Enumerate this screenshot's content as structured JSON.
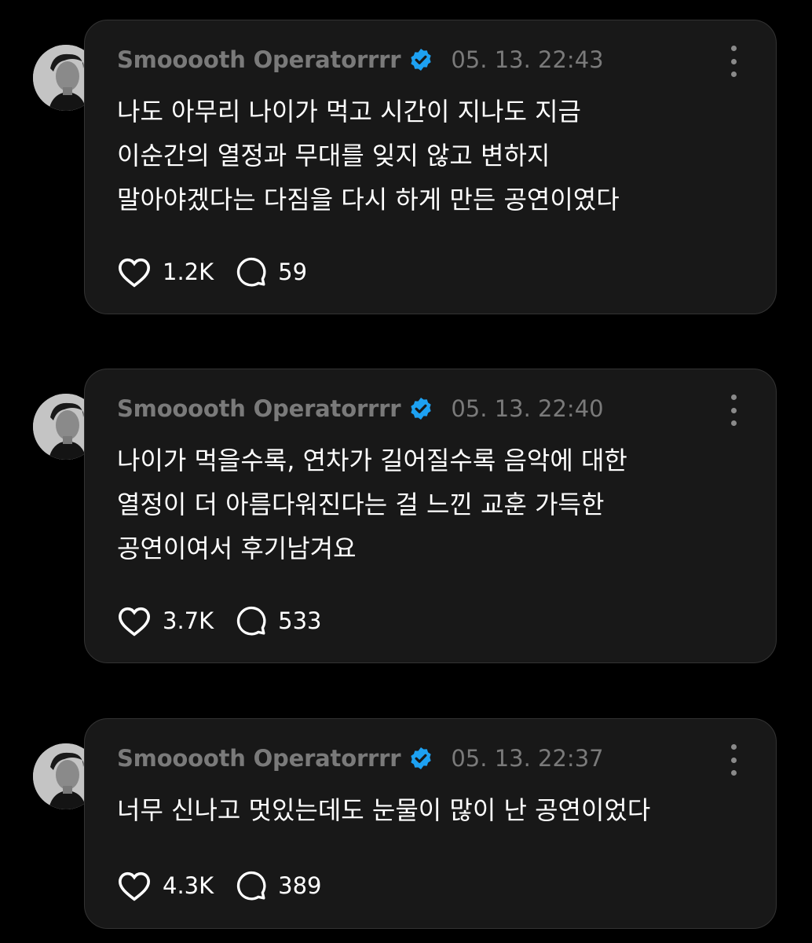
{
  "posts": [
    {
      "author": "Smooooth Operatorrrr",
      "time": "05. 13. 22:43",
      "lines": [
        "나도 아무리 나이가 먹고 시간이 지나도 지금",
        "이순간의 열정과 무대를 잊지 않고 변하지",
        "말아야겠다는 다짐을 다시 하게 만든 공연이였다"
      ],
      "likes": "1.2K",
      "replies": "59"
    },
    {
      "author": "Smooooth Operatorrrr",
      "time": "05. 13. 22:40",
      "lines": [
        "나이가 먹을수록, 연차가 길어질수록 음악에 대한",
        "열정이 더 아름다워진다는 걸 느낀 교훈 가득한",
        "공연이여서 후기남겨요"
      ],
      "likes": "3.7K",
      "replies": "533"
    },
    {
      "author": "Smooooth Operatorrrr",
      "time": "05. 13. 22:37",
      "lines": [
        "너무 신나고 멋있는데도 눈물이 많이 난 공연이었다"
      ],
      "likes": "4.3K",
      "replies": "389"
    }
  ],
  "icons": {
    "verified": "verified-badge-icon",
    "like": "heart-icon",
    "reply": "speech-bubble-icon",
    "more": "more-vertical-icon"
  },
  "colors": {
    "background": "#000000",
    "card": "#181818",
    "border": "#333333",
    "verified": "#1da1f2",
    "muted": "#7a7a7a"
  }
}
